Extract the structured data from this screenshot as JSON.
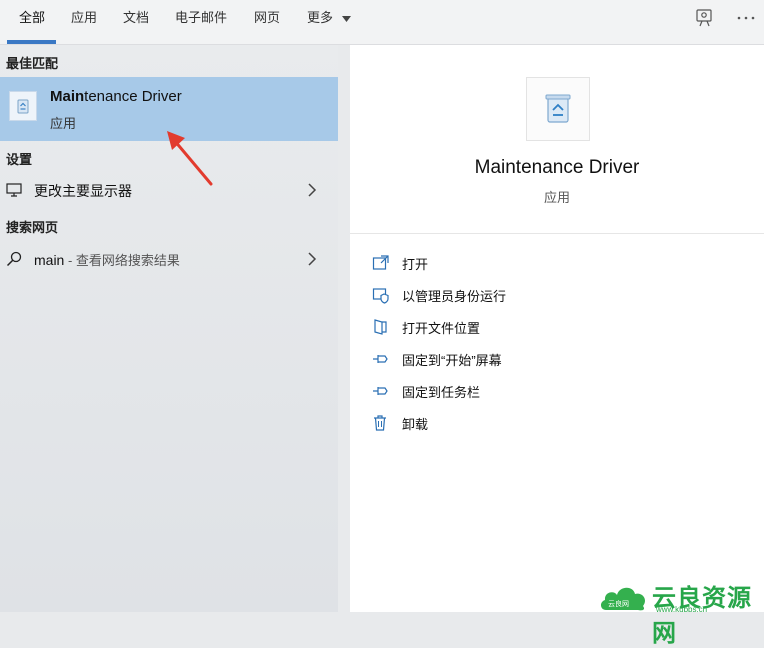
{
  "tabs": [
    {
      "label": "全部"
    },
    {
      "label": "应用"
    },
    {
      "label": "文档"
    },
    {
      "label": "电子邮件"
    },
    {
      "label": "网页"
    },
    {
      "label": "更多"
    }
  ],
  "top_icons": [
    "feedback-icon",
    "more-options-icon"
  ],
  "left": {
    "best_match_header": "最佳匹配",
    "best_match": {
      "title_bold": "Main",
      "title_rest": "tenance Driver",
      "subtitle": "应用",
      "icon": "recycle-bin-icon"
    },
    "settings_header": "设置",
    "settings_item": {
      "label": "更改主要显示器",
      "icon": "monitor-icon"
    },
    "web_header": "搜索网页",
    "web_item": {
      "query": "main",
      "suffix": " - 查看网络搜索结果",
      "icon": "search-icon"
    }
  },
  "right": {
    "app_title": "Maintenance Driver",
    "app_subtitle": "应用",
    "actions": [
      {
        "label": "打开",
        "icon": "open-icon"
      },
      {
        "label": "以管理员身份运行",
        "icon": "admin-shield-icon"
      },
      {
        "label": "打开文件位置",
        "icon": "file-location-icon"
      },
      {
        "label": "固定到“开始”屏幕",
        "icon": "pin-icon"
      },
      {
        "label": "固定到任务栏",
        "icon": "pin-icon"
      },
      {
        "label": "卸载",
        "icon": "trash-icon"
      }
    ]
  },
  "watermark": {
    "text": "云良资源网",
    "url": "www.kubbs.cn",
    "badge": "云良网"
  },
  "colors": {
    "accent": "#3a78c4",
    "selection": "#a7c9e8",
    "arrow": "#e23b2e",
    "watermark": "#27a64a"
  }
}
